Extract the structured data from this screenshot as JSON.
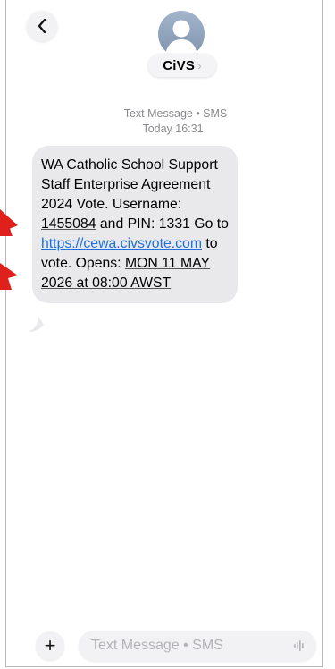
{
  "header": {
    "contact_name": "CiVS",
    "contact_chevron": "›"
  },
  "thread": {
    "message_type": "Text Message • SMS",
    "timestamp": "Today 16:31",
    "message": {
      "t1": "WA Catholic School Support Staff Enterprise Agreement 2024 Vote. Username: ",
      "username": "1455084",
      "t2": " and PIN: 1331 Go to ",
      "link": "https://cewa.civsvote.com",
      "t3": " to vote. Opens: ",
      "opens": "MON 11 MAY 2026 at 08:00 AWST"
    }
  },
  "compose": {
    "placeholder": "Text Message • SMS",
    "plus_icon": "+"
  },
  "colors": {
    "bubble": "#e9e9eb",
    "link": "#1e6fe0",
    "annotation_arrow": "#e0201c"
  }
}
